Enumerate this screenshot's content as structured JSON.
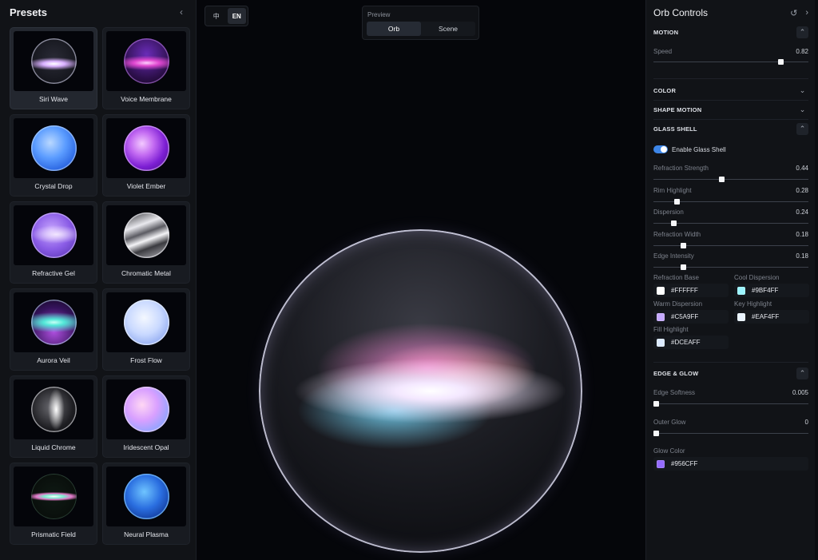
{
  "presets": {
    "title": "Presets",
    "items": [
      {
        "label": "Siri Wave",
        "orb": "orb-siri",
        "active": true
      },
      {
        "label": "Voice Membrane",
        "orb": "orb-voice"
      },
      {
        "label": "Crystal Drop",
        "orb": "orb-crystal"
      },
      {
        "label": "Violet Ember",
        "orb": "orb-violet"
      },
      {
        "label": "Refractive Gel",
        "orb": "orb-gel"
      },
      {
        "label": "Chromatic Metal",
        "orb": "orb-chrome-metal"
      },
      {
        "label": "Aurora Veil",
        "orb": "orb-aurora"
      },
      {
        "label": "Frost Flow",
        "orb": "orb-frost"
      },
      {
        "label": "Liquid Chrome",
        "orb": "orb-liquid"
      },
      {
        "label": "Iridescent Opal",
        "orb": "orb-opal"
      },
      {
        "label": "Prismatic Field",
        "orb": "orb-prismatic"
      },
      {
        "label": "Neural Plasma",
        "orb": "orb-plasma"
      }
    ]
  },
  "language": {
    "zh": "中",
    "en": "EN",
    "selected": "EN"
  },
  "preview": {
    "label": "Preview",
    "tabs": [
      "Orb",
      "Scene"
    ],
    "selected": "Orb"
  },
  "controls": {
    "title": "Orb Controls",
    "motion": {
      "title": "MOTION",
      "speed_label": "Speed",
      "speed_value": "0.82",
      "speed": 0.82
    },
    "color": {
      "title": "COLOR"
    },
    "shape_motion": {
      "title": "SHAPE MOTION"
    },
    "glass_shell": {
      "title": "GLASS SHELL",
      "enable_label": "Enable Glass Shell",
      "enabled": true,
      "sliders": [
        {
          "label": "Refraction Strength",
          "value": "0.44",
          "fraction": 0.44
        },
        {
          "label": "Rim Highlight",
          "value": "0.28",
          "fraction": 0.15
        },
        {
          "label": "Dispersion",
          "value": "0.24",
          "fraction": 0.13
        },
        {
          "label": "Refraction Width",
          "value": "0.18",
          "fraction": 0.19
        },
        {
          "label": "Edge Intensity",
          "value": "0.18",
          "fraction": 0.19
        }
      ],
      "colors": [
        {
          "label": "Refraction Base",
          "hex": "#FFFFFF"
        },
        {
          "label": "Cool Dispersion",
          "hex": "#9BF4FF"
        },
        {
          "label": "Warm Dispersion",
          "hex": "#C5A9FF"
        },
        {
          "label": "Key Highlight",
          "hex": "#EAF4FF"
        },
        {
          "label": "Fill Highlight",
          "hex": "#DCEAFF"
        }
      ]
    },
    "edge_glow": {
      "title": "EDGE & GLOW",
      "softness_label": "Edge Softness",
      "softness_value": "0.005",
      "softness": 0.005,
      "outer_label": "Outer Glow",
      "outer_value": "0",
      "outer": 0,
      "glow_color_label": "Glow Color",
      "glow_color_hex": "#956CFF"
    }
  }
}
